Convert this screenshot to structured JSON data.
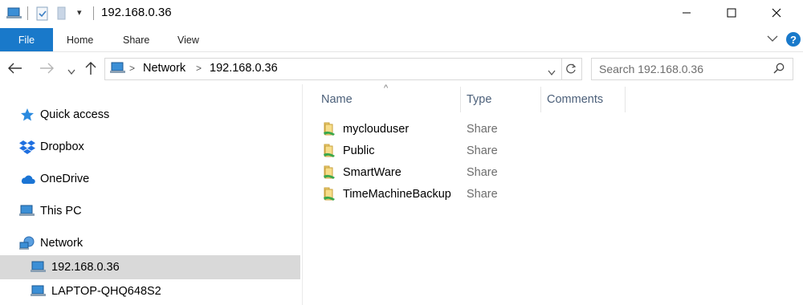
{
  "window": {
    "title": "192.168.0.36",
    "quick_access_dropdown": "▾",
    "minimize": "—",
    "maximize": "☐",
    "close": "✕"
  },
  "ribbon": {
    "tabs": [
      {
        "label": "File"
      },
      {
        "label": "Home"
      },
      {
        "label": "Share"
      },
      {
        "label": "View"
      }
    ],
    "expand_chevron": "⌄",
    "help": "?"
  },
  "navigation": {
    "back": "←",
    "forward": "→",
    "recent": "⌄",
    "up": "↑"
  },
  "address": {
    "crumbs": [
      "Network",
      "192.168.0.36"
    ],
    "separator": ">",
    "dropdown": "⌄"
  },
  "search": {
    "placeholder": "Search 192.168.0.36",
    "icon": "search-icon"
  },
  "nav_pane": {
    "items": [
      {
        "label": "Quick access",
        "icon": "star-icon"
      },
      {
        "label": "Dropbox",
        "icon": "dropbox-icon"
      },
      {
        "label": "OneDrive",
        "icon": "cloud-icon"
      },
      {
        "label": "This PC",
        "icon": "computer-icon"
      },
      {
        "label": "Network",
        "icon": "network-icon"
      },
      {
        "label": "192.168.0.36",
        "icon": "computer-icon",
        "selected": true
      },
      {
        "label": "LAPTOP-QHQ648S2",
        "icon": "computer-icon"
      }
    ]
  },
  "file_list": {
    "columns": [
      "Name",
      "Type",
      "Comments"
    ],
    "sort_indicator": "^",
    "rows": [
      {
        "name": "myclouduser",
        "type": "Share"
      },
      {
        "name": "Public",
        "type": "Share"
      },
      {
        "name": "SmartWare",
        "type": "Share"
      },
      {
        "name": "TimeMachineBackup",
        "type": "Share"
      }
    ]
  },
  "colors": {
    "accent": "#1979ca",
    "selected_bg": "#d9d9d9",
    "header_text": "#4c607a",
    "muted_text": "#6d6d6d"
  }
}
